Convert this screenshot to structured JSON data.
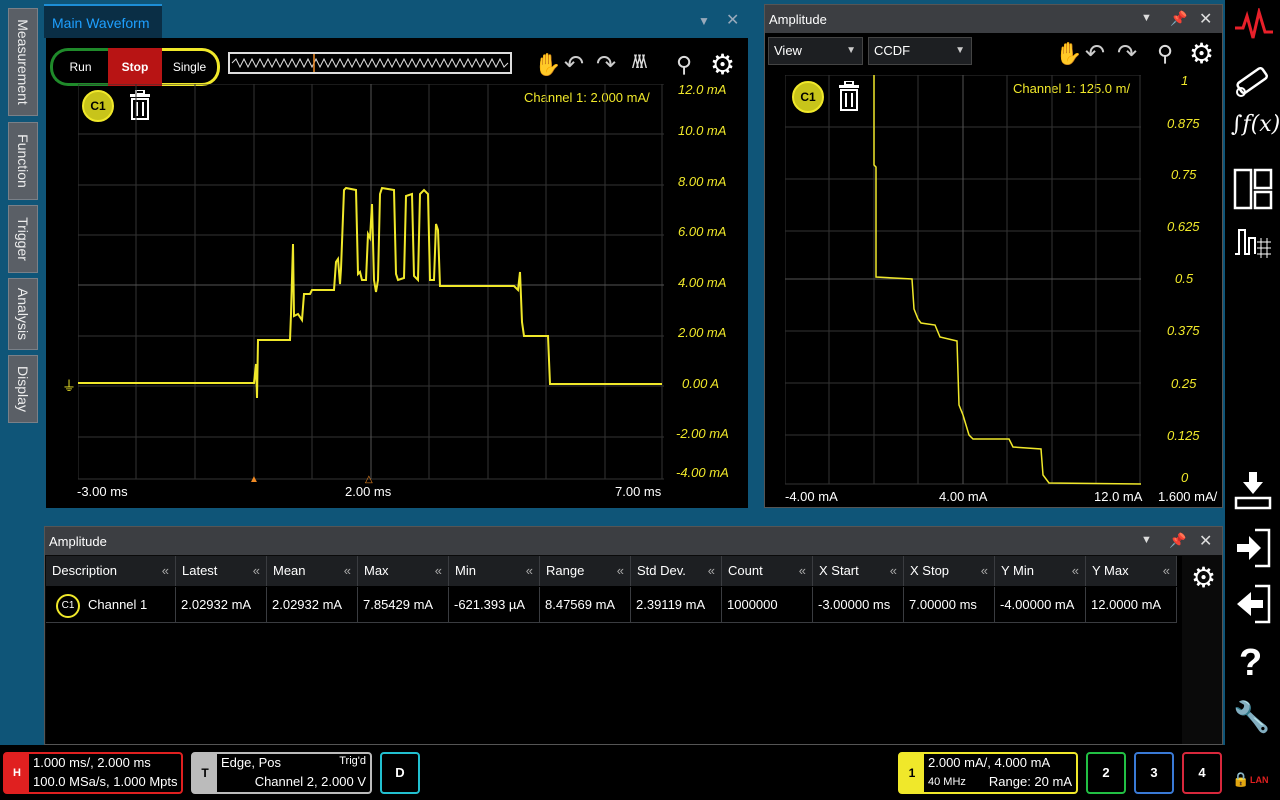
{
  "left_tabs": [
    "Measurement",
    "Function",
    "Trigger",
    "Analysis",
    "Display"
  ],
  "main_waveform": {
    "title": "Main Waveform",
    "run_label": "Run",
    "stop_label": "Stop",
    "single_label": "Single",
    "channel_badge": "C1",
    "channel_scale": "Channel 1:  2.000 mA/",
    "y_ticks": [
      "12.0 mA",
      "10.0 mA",
      "8.00 mA",
      "6.00 mA",
      "4.00 mA",
      "2.00 mA",
      "0.00 A",
      "-2.00 mA",
      "-4.00 mA"
    ],
    "x_ticks": [
      "-3.00 ms",
      "2.00 ms",
      "7.00 ms"
    ]
  },
  "amplitude_panel": {
    "title": "Amplitude",
    "view_label": "View",
    "mode_label": "CCDF",
    "channel_badge": "C1",
    "channel_scale": "Channel 1:  125.0 m/",
    "y_ticks": [
      "1",
      "0.875",
      "0.75",
      "0.625",
      "0.5",
      "0.375",
      "0.25",
      "0.125",
      "0"
    ],
    "x_ticks": [
      "-4.00 mA",
      "4.00 mA",
      "12.0 mA",
      "1.600 mA/"
    ]
  },
  "measurement_table": {
    "title": "Amplitude",
    "columns": [
      "Description",
      "Latest",
      "Mean",
      "Max",
      "Min",
      "Range",
      "Std Dev.",
      "Count",
      "X Start",
      "X Stop",
      "Y Min",
      "Y Max"
    ],
    "rows": [
      {
        "badge": "C1",
        "cells": [
          "Channel 1",
          "2.02932 mA",
          "2.02932 mA",
          "7.85429 mA",
          "-621.393 µA",
          "8.47569 mA",
          "2.39119 mA",
          "1000000",
          "-3.00000 ms",
          "7.00000 ms",
          "-4.00000 mA",
          "12.0000 mA"
        ]
      }
    ]
  },
  "status_bar": {
    "horizontal_badge": "H",
    "horizontal_line1": "1.000 ms/, 2.000 ms",
    "horizontal_line2": "100.0 MSa/s, 1.000 Mpts",
    "trigger_badge": "T",
    "trigger_line1": "Edge, Pos",
    "trigger_state": "Trig'd",
    "trigger_line2": "Channel 2, 2.000 V",
    "digital_label": "D",
    "ch1_badge": "1",
    "ch1_line1": "2.000 mA/, 4.000 mA",
    "ch1_bandwidth": "40 MHz",
    "ch1_range": "Range: 20 mA",
    "ch2_label": "2",
    "ch3_label": "3",
    "ch4_label": "4",
    "lan_label": "LAN"
  },
  "colors": {
    "trace": "#f0e82a",
    "run": "#1f8a2a",
    "stop": "#c81e1e",
    "single": "#f0e82a",
    "ch2": "#22c044",
    "ch3": "#3a7ad6",
    "ch4": "#d8283c"
  }
}
